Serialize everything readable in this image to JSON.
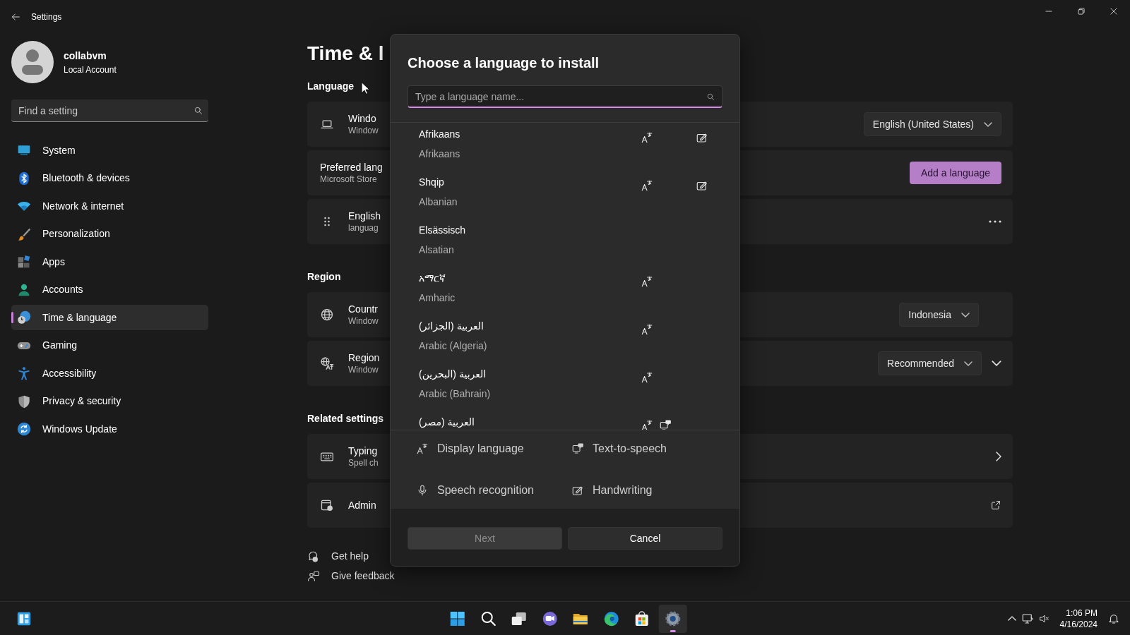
{
  "window": {
    "title": "Settings"
  },
  "user": {
    "name": "collabvm",
    "account_type": "Local Account"
  },
  "search": {
    "placeholder": "Find a setting"
  },
  "nav": [
    {
      "label": "System",
      "selected": false
    },
    {
      "label": "Bluetooth & devices",
      "selected": false
    },
    {
      "label": "Network & internet",
      "selected": false
    },
    {
      "label": "Personalization",
      "selected": false
    },
    {
      "label": "Apps",
      "selected": false
    },
    {
      "label": "Accounts",
      "selected": false
    },
    {
      "label": "Time & language",
      "selected": true
    },
    {
      "label": "Gaming",
      "selected": false
    },
    {
      "label": "Accessibility",
      "selected": false
    },
    {
      "label": "Privacy & security",
      "selected": false
    },
    {
      "label": "Windows Update",
      "selected": false
    }
  ],
  "page": {
    "title": "Time & l",
    "sections": [
      {
        "heading": "Language",
        "cards": [
          {
            "kind": "dropdown",
            "title": "Windo",
            "subtitle": "Window",
            "control": "English (United States)"
          },
          {
            "kind": "button",
            "title": "Preferred lang",
            "subtitle": "Microsoft Store",
            "control": "Add a language"
          },
          {
            "kind": "more",
            "title": "English",
            "subtitle": "languag"
          }
        ]
      },
      {
        "heading": "Region",
        "cards": [
          {
            "kind": "dropdown",
            "title": "Countr",
            "subtitle": "Window",
            "control": "Indonesia"
          },
          {
            "kind": "dropdown_expand",
            "title": "Region",
            "subtitle": "Window",
            "control": "Recommended"
          }
        ]
      },
      {
        "heading": "Related settings",
        "cards": [
          {
            "kind": "link",
            "title": "Typing",
            "subtitle": "Spell ch"
          },
          {
            "kind": "external",
            "title": "Admin"
          }
        ]
      }
    ]
  },
  "help_links": [
    {
      "label": "Get help"
    },
    {
      "label": "Give feedback"
    }
  ],
  "dialog": {
    "title": "Choose a language to install",
    "search": {
      "placeholder": "Type a language name...",
      "focused": true
    },
    "languages": [
      {
        "native": "Afrikaans",
        "english": "Afrikaans",
        "display_language": true,
        "text_to_speech": false,
        "handwriting": true
      },
      {
        "native": "Shqip",
        "english": "Albanian",
        "display_language": true,
        "text_to_speech": false,
        "handwriting": true
      },
      {
        "native": "Elsässisch",
        "english": "Alsatian",
        "display_language": false,
        "text_to_speech": false,
        "handwriting": false
      },
      {
        "native": "አማርኛ",
        "english": "Amharic",
        "display_language": true,
        "text_to_speech": false,
        "handwriting": false
      },
      {
        "native": "العربية (الجزائر)",
        "english": "Arabic (Algeria)",
        "display_language": true,
        "text_to_speech": false,
        "handwriting": false
      },
      {
        "native": "العربية (البحرين)",
        "english": "Arabic (Bahrain)",
        "display_language": true,
        "text_to_speech": false,
        "handwriting": false
      },
      {
        "native": "العربية (مصر)",
        "display_language": true,
        "text_to_speech": true,
        "handwriting": false
      }
    ],
    "legend": [
      {
        "label": "Display language"
      },
      {
        "label": "Text-to-speech"
      },
      {
        "label": "Speech recognition"
      },
      {
        "label": "Handwriting"
      }
    ],
    "buttons": [
      {
        "label": "Next",
        "kind": "primary",
        "disabled": true
      },
      {
        "label": "Cancel",
        "kind": "secondary",
        "disabled": false
      }
    ]
  },
  "taskbar": {
    "apps": [
      {
        "selected": false
      },
      {
        "selected": false
      },
      {
        "selected": false
      },
      {
        "selected": false
      },
      {
        "selected": false
      },
      {
        "selected": false
      },
      {
        "selected": false
      },
      {
        "selected": true
      }
    ],
    "clock": {
      "time": "1:06 PM",
      "date": "4/16/2024"
    }
  }
}
